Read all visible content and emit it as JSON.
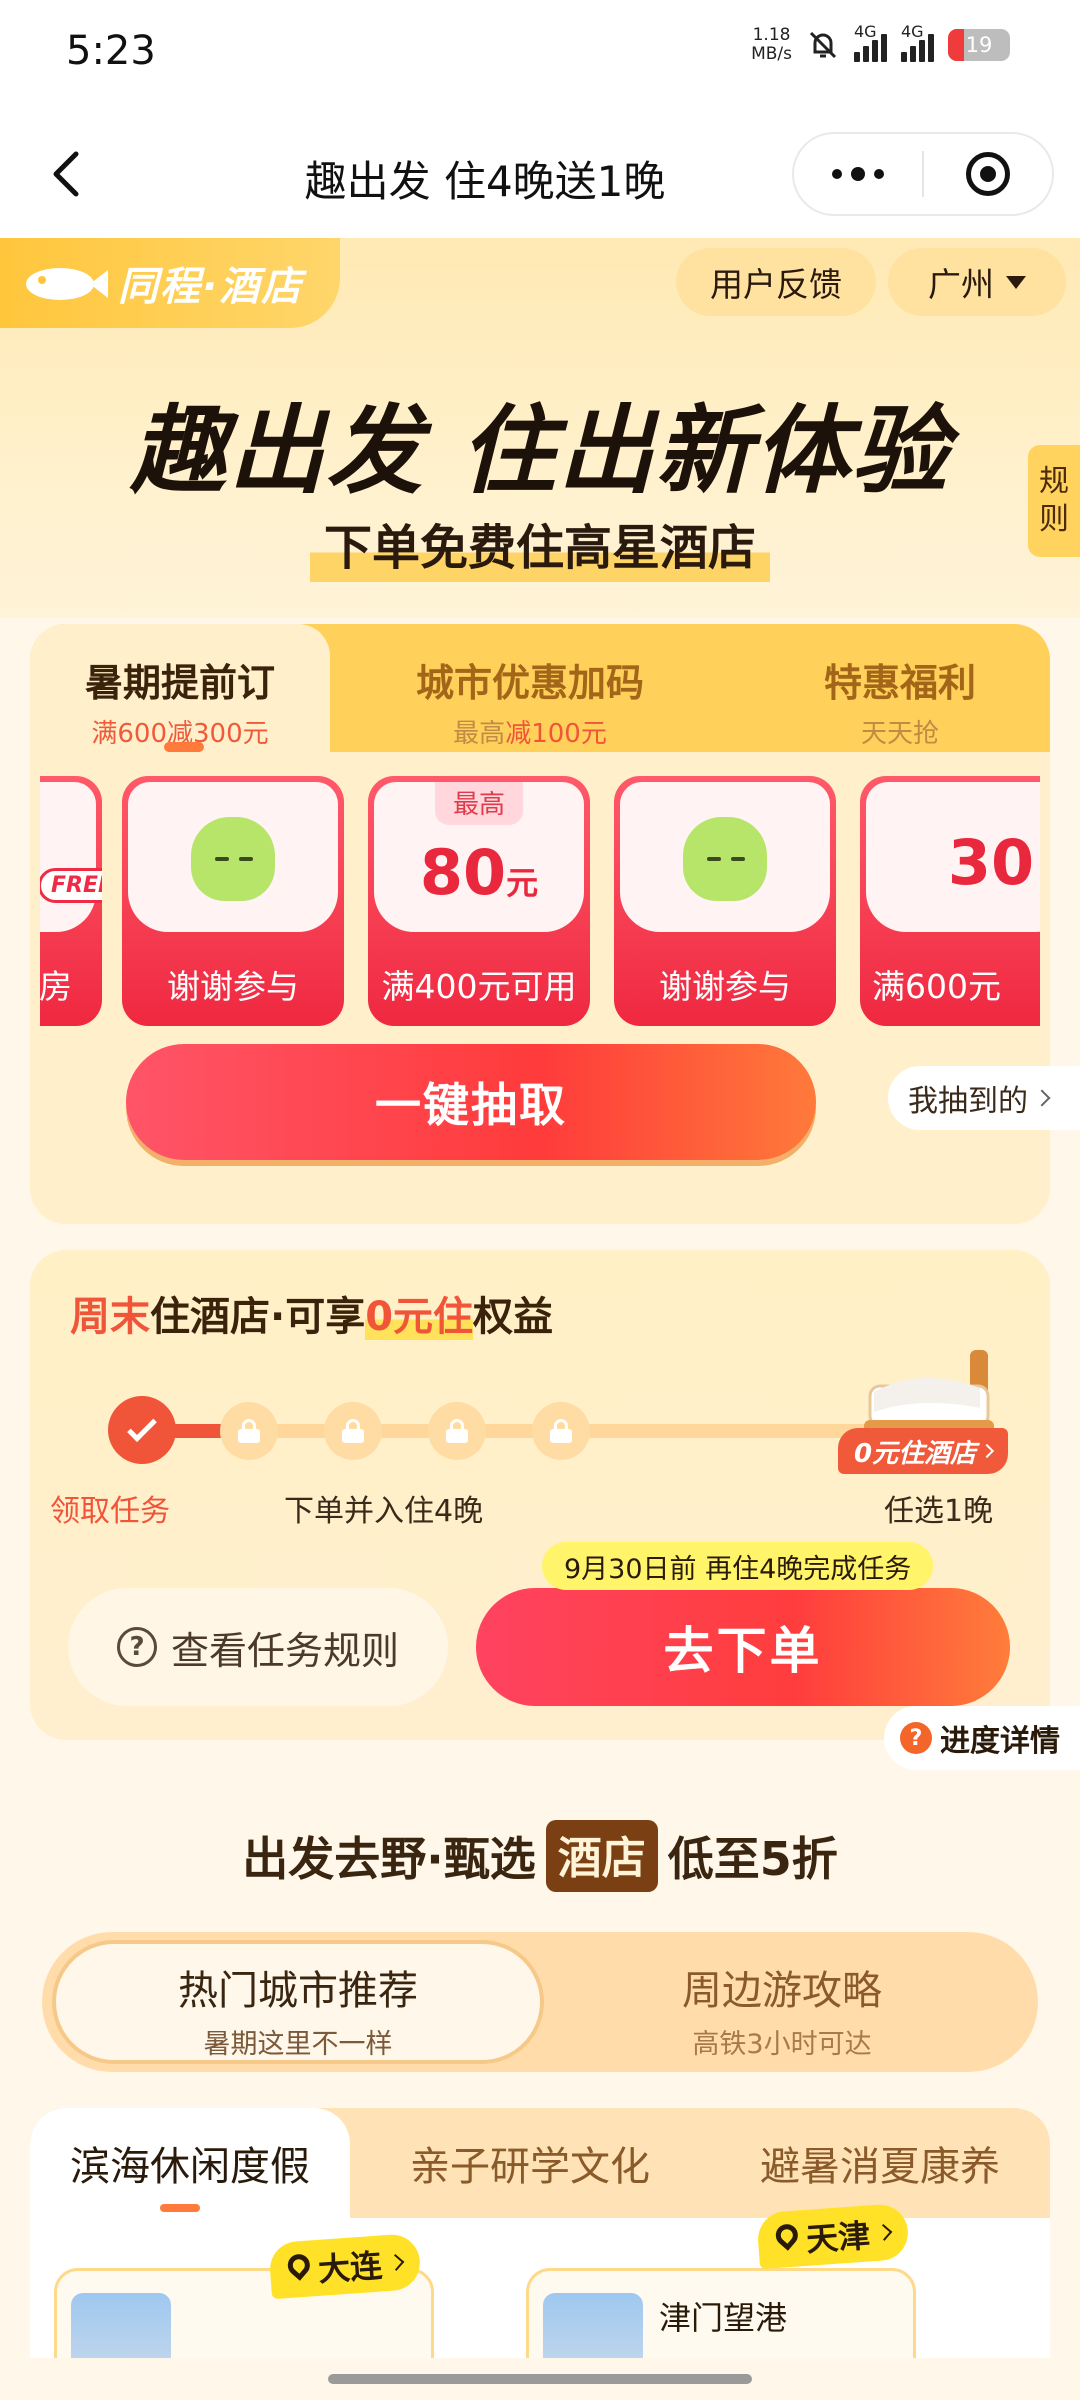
{
  "status_bar": {
    "time": "5:23",
    "net_speed_value": "1.18",
    "net_speed_unit": "MB/s",
    "signal1_label": "4G",
    "signal2_label": "4G",
    "battery": "19"
  },
  "nav": {
    "title": "趣出发 住4晚送1晚"
  },
  "header": {
    "logo_text": "同程·酒店",
    "feedback_label": "用户反馈",
    "city_label": "广州",
    "main_title": "趣出发 住出新体验",
    "sub_title": "下单免费住高星酒店",
    "rules_tab": [
      "规",
      "则"
    ]
  },
  "lottery": {
    "tabs": [
      {
        "label": "暑期提前订",
        "sub": "满600减300元"
      },
      {
        "label": "城市优惠加码",
        "sub_prefix": "最高",
        "sub_highlight": "减100元"
      },
      {
        "label": "特惠福利",
        "sub": "天天抢"
      }
    ],
    "prizes": [
      {
        "caption": "酒店升房",
        "visible_caption": "房升房",
        "tag": "FREE"
      },
      {
        "caption": "谢谢参与"
      },
      {
        "badge": "最高",
        "amount": "80",
        "unit": "元",
        "caption": "满400元可用"
      },
      {
        "caption": "谢谢参与"
      },
      {
        "amount": "30",
        "caption": "满600元"
      }
    ],
    "draw_button": "一键抽取",
    "my_prizes": "我抽到的"
  },
  "task": {
    "title_part1": "周末",
    "title_part2": "住酒店·可享",
    "title_highlight": "0元住",
    "title_part3": "权益",
    "steps": [
      "领取任务",
      "下单并入住4晚",
      "任选1晚"
    ],
    "zero_badge": "0元住酒店",
    "rule_button": "查看任务规则",
    "order_button": "去下单",
    "order_tip": "9月30日前 再住4晚完成任务",
    "progress_detail": "进度详情"
  },
  "section": {
    "title_part1": "出发去野·甄选",
    "title_badge": "酒店",
    "title_part2": "低至5折",
    "segments": [
      {
        "label": "热门城市推荐",
        "sub": "暑期这里不一样"
      },
      {
        "label": "周边游攻略",
        "sub": "高铁3小时可达"
      }
    ],
    "categories": [
      "滨海休闲度假",
      "亲子研学文化",
      "避暑消夏康养"
    ],
    "cards": [
      {
        "city": "大连",
        "name": ""
      },
      {
        "city": "天津",
        "name": "津门望港"
      }
    ]
  },
  "colors": {
    "accent_red": "#f0553a",
    "brand_yellow": "#ffd15a",
    "background": "#fff7e9"
  }
}
